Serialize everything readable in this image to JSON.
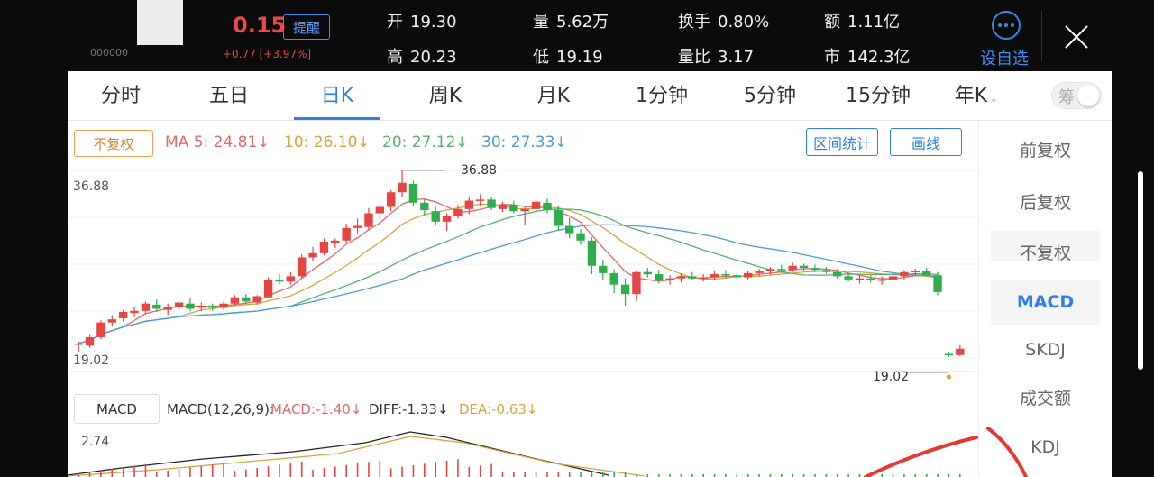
{
  "quote": {
    "price": "0.15",
    "code": "000000",
    "change": "+0.77  [+3.97%]",
    "alert_label": "提醒",
    "stats": [
      {
        "k": "开",
        "v": "19.30"
      },
      {
        "k": "量",
        "v": "5.62万"
      },
      {
        "k": "换手",
        "v": "0.80%"
      },
      {
        "k": "额",
        "v": "1.11亿"
      },
      {
        "k": "高",
        "v": "20.23"
      },
      {
        "k": "低",
        "v": "19.19"
      },
      {
        "k": "量比",
        "v": "3.17"
      },
      {
        "k": "市",
        "v": "142.3亿"
      }
    ],
    "fav_label": "设自选"
  },
  "tabs": [
    "分时",
    "五日",
    "日K",
    "周K",
    "月K",
    "1分钟",
    "5分钟",
    "15分钟",
    "年K"
  ],
  "active_tab": "日K",
  "toggle_label": "筹",
  "ma_row": {
    "fq_label": "不复权",
    "ma5": "MA 5: 24.81",
    "ma10": "10: 26.10",
    "ma20": "20: 27.12",
    "ma30": "30: 27.33",
    "arrow": "↓",
    "range_label": "区间统计",
    "draw_label": "画线"
  },
  "chart": {
    "y_top": "36.88",
    "y_bottom": "19.02",
    "max_label": "36.88",
    "min_label": "19.02"
  },
  "macd": {
    "btn_label": "MACD",
    "title": "MACD(12,26,9):",
    "macd_val": "MACD:-1.40",
    "diff_val": "DIFF:-1.33",
    "dea_val": "DEA:-0.63",
    "arrow": "↓",
    "y_top": "2.74"
  },
  "side_menu": [
    "前复权",
    "后复权",
    "不复权",
    "MACD",
    "SKDJ",
    "成交额",
    "KDJ"
  ],
  "colors": {
    "up": "#e64545",
    "down": "#2fae4e",
    "accent": "#2e7fe6",
    "ma5": "#e06a6a",
    "ma10": "#d4a640",
    "ma20": "#57b06d",
    "ma30": "#4d9bd6"
  },
  "chart_data": {
    "type": "candlestick",
    "y_range": [
      19.02,
      36.88
    ],
    "candles": [
      [
        20.3,
        20.6,
        19.6,
        20.4
      ],
      [
        20.2,
        21.3,
        20.0,
        21.0
      ],
      [
        21.0,
        22.6,
        20.8,
        22.4
      ],
      [
        22.4,
        23.1,
        22.0,
        22.7
      ],
      [
        22.8,
        23.6,
        22.5,
        23.4
      ],
      [
        23.3,
        23.9,
        22.9,
        23.5
      ],
      [
        23.5,
        24.4,
        23.2,
        24.2
      ],
      [
        24.1,
        24.6,
        23.4,
        23.7
      ],
      [
        23.6,
        24.2,
        23.1,
        23.9
      ],
      [
        23.9,
        24.5,
        23.6,
        24.3
      ],
      [
        24.2,
        24.7,
        23.5,
        23.7
      ],
      [
        23.8,
        24.3,
        23.5,
        24.0
      ],
      [
        24.0,
        24.2,
        23.5,
        23.8
      ],
      [
        23.8,
        24.4,
        23.6,
        24.2
      ],
      [
        24.2,
        25.0,
        24.0,
        24.8
      ],
      [
        24.8,
        25.1,
        24.2,
        24.4
      ],
      [
        24.3,
        25.0,
        24.1,
        24.9
      ],
      [
        24.8,
        26.7,
        24.7,
        26.5
      ],
      [
        26.5,
        27.0,
        26.0,
        26.3
      ],
      [
        26.3,
        27.2,
        26.0,
        26.8
      ],
      [
        26.8,
        28.9,
        26.6,
        28.6
      ],
      [
        28.6,
        29.6,
        28.2,
        29.0
      ],
      [
        29.0,
        30.4,
        28.8,
        30.1
      ],
      [
        30.0,
        30.4,
        29.5,
        30.2
      ],
      [
        30.2,
        31.8,
        30.0,
        31.4
      ],
      [
        31.4,
        32.3,
        30.8,
        31.6
      ],
      [
        31.5,
        33.3,
        31.2,
        32.8
      ],
      [
        32.8,
        33.6,
        32.3,
        33.4
      ],
      [
        33.4,
        35.0,
        33.0,
        34.8
      ],
      [
        34.8,
        36.88,
        34.4,
        35.7
      ],
      [
        35.6,
        35.9,
        33.5,
        33.8
      ],
      [
        33.8,
        34.1,
        32.6,
        33.1
      ],
      [
        33.0,
        33.4,
        31.6,
        32.0
      ],
      [
        32.0,
        32.8,
        31.1,
        32.5
      ],
      [
        32.5,
        33.6,
        32.3,
        33.2
      ],
      [
        33.2,
        34.4,
        32.7,
        34.0
      ],
      [
        34.0,
        34.6,
        33.5,
        34.1
      ],
      [
        34.1,
        34.3,
        33.1,
        33.3
      ],
      [
        33.2,
        33.9,
        32.9,
        33.6
      ],
      [
        33.6,
        34.0,
        32.8,
        33.0
      ],
      [
        33.0,
        33.4,
        31.7,
        33.2
      ],
      [
        33.2,
        34.1,
        32.9,
        33.9
      ],
      [
        33.8,
        34.2,
        32.8,
        33.1
      ],
      [
        33.1,
        33.5,
        31.2,
        31.6
      ],
      [
        31.6,
        32.4,
        30.4,
        30.9
      ],
      [
        30.9,
        31.3,
        29.8,
        30.2
      ],
      [
        30.2,
        30.5,
        27.0,
        27.8
      ],
      [
        27.8,
        28.4,
        26.4,
        27.1
      ],
      [
        27.1,
        27.5,
        25.2,
        26.0
      ],
      [
        26.0,
        26.6,
        24.0,
        25.1
      ],
      [
        25.1,
        27.4,
        24.4,
        27.2
      ],
      [
        27.2,
        27.6,
        26.7,
        27.0
      ],
      [
        27.0,
        27.4,
        26.1,
        26.4
      ],
      [
        26.4,
        26.9,
        26.0,
        26.6
      ],
      [
        26.6,
        27.1,
        26.2,
        26.8
      ],
      [
        26.8,
        27.2,
        26.4,
        26.6
      ],
      [
        26.6,
        27.0,
        26.3,
        26.7
      ],
      [
        26.7,
        27.3,
        26.4,
        27.0
      ],
      [
        27.0,
        27.4,
        26.6,
        26.9
      ],
      [
        26.9,
        27.1,
        26.5,
        26.7
      ],
      [
        26.7,
        27.3,
        26.5,
        27.1
      ],
      [
        27.1,
        27.5,
        26.8,
        27.3
      ],
      [
        27.3,
        27.7,
        26.9,
        27.5
      ],
      [
        27.5,
        27.9,
        27.1,
        27.4
      ],
      [
        27.4,
        28.1,
        27.2,
        27.8
      ],
      [
        27.8,
        28.0,
        27.3,
        27.6
      ],
      [
        27.6,
        27.9,
        27.2,
        27.4
      ],
      [
        27.4,
        27.7,
        27.0,
        27.2
      ],
      [
        27.2,
        27.5,
        26.6,
        26.8
      ],
      [
        26.8,
        27.1,
        26.3,
        26.5
      ],
      [
        26.5,
        26.9,
        26.1,
        26.6
      ],
      [
        26.6,
        26.9,
        26.2,
        26.4
      ],
      [
        26.4,
        26.8,
        26.0,
        26.5
      ],
      [
        26.5,
        27.0,
        26.3,
        26.8
      ],
      [
        26.8,
        27.4,
        26.5,
        27.2
      ],
      [
        27.2,
        27.5,
        26.9,
        27.3
      ],
      [
        27.3,
        27.6,
        26.8,
        26.9
      ],
      [
        26.9,
        27.2,
        25.0,
        25.3
      ],
      [
        19.4,
        19.6,
        19.1,
        19.3
      ],
      [
        19.3,
        20.23,
        19.19,
        19.9
      ]
    ]
  }
}
